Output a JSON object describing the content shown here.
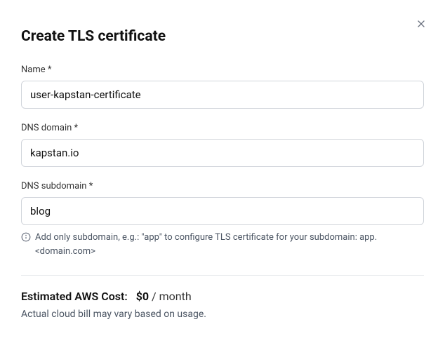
{
  "header": {
    "title": "Create TLS certificate"
  },
  "form": {
    "name": {
      "label": "Name *",
      "value": "user-kapstan-certificate"
    },
    "dns_domain": {
      "label": "DNS domain *",
      "value": "kapstan.io"
    },
    "dns_subdomain": {
      "label": "DNS subdomain *",
      "value": "blog",
      "helper": "Add only subdomain, e.g.: \"app\" to configure TLS certificate for your subdomain: app.<domain.com>"
    }
  },
  "cost": {
    "label": "Estimated AWS Cost:",
    "amount": "$0",
    "unit": " / month",
    "note": "Actual cloud bill may vary based on usage."
  }
}
